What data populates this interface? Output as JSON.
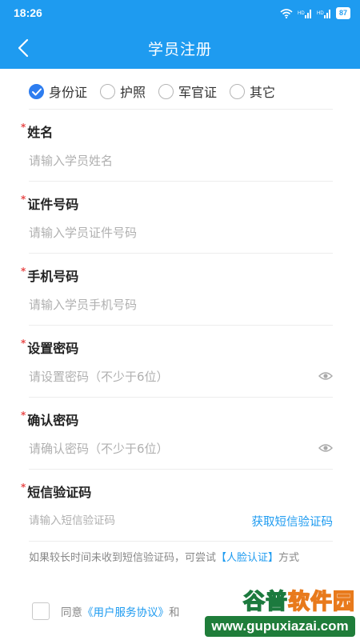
{
  "status_bar": {
    "time": "18:26",
    "signal_1": "ᴴᵈ",
    "signal_2": "ᴴᵈ",
    "battery": "87"
  },
  "header": {
    "title": "学员注册"
  },
  "id_type": {
    "options": [
      {
        "label": "身份证",
        "checked": true
      },
      {
        "label": "护照",
        "checked": false
      },
      {
        "label": "军官证",
        "checked": false
      },
      {
        "label": "其它",
        "checked": false
      }
    ]
  },
  "form": {
    "required_mark": "*",
    "name": {
      "label": "姓名",
      "placeholder": "请输入学员姓名"
    },
    "id_number": {
      "label": "证件号码",
      "placeholder": "请输入学员证件号码"
    },
    "phone": {
      "label": "手机号码",
      "placeholder": "请输入学员手机号码"
    },
    "password": {
      "label": "设置密码",
      "placeholder": "请设置密码（不少于6位）"
    },
    "confirm_password": {
      "label": "确认密码",
      "placeholder": "请确认密码（不少于6位）"
    },
    "sms_code": {
      "label": "短信验证码",
      "placeholder": "请输入短信验证码",
      "button": "获取短信验证码"
    }
  },
  "hint": {
    "prefix": "如果较长时间未收到短信验证码，可尝试",
    "link": "【人脸认证】",
    "suffix": "方式"
  },
  "agreement": {
    "prefix": "同意",
    "link": "《用户服务协议》",
    "suffix": "和"
  },
  "watermark": {
    "cn_1": "谷普",
    "cn_2": "软件园",
    "url": "www.gupuxiazai.com"
  },
  "colors": {
    "brand": "#1e9bf0",
    "required": "#e84a4a",
    "link": "#1e9bf0"
  }
}
